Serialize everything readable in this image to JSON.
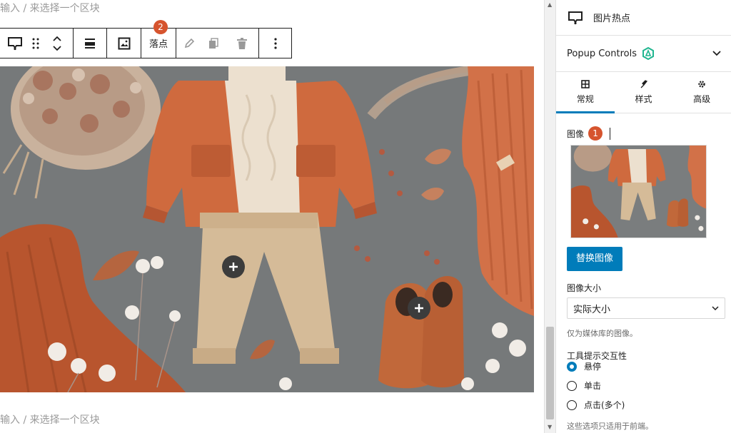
{
  "editor": {
    "placeholder_top": "输入 / 来选择一个区块",
    "placeholder_bottom": "输入 / 来选择一个区块",
    "toolbar": {
      "block_icon": "hotspot-block-icon",
      "drag_icon": "drag-handle-icon",
      "move_icon": "move-up-down-icon",
      "align_icon": "align-icon",
      "image_icon": "image-icon",
      "hotspot_label": "落点",
      "edit_icon": "pencil-icon",
      "duplicate_icon": "duplicate-icon",
      "delete_icon": "trash-icon",
      "more_icon": "more-vertical-icon",
      "badge": "2"
    },
    "hotspots": [
      {
        "icon": "plus-icon"
      },
      {
        "icon": "plus-icon"
      }
    ]
  },
  "sidebar": {
    "header_title": "图片热点",
    "panel_title": "Popup Controls",
    "tabs": [
      {
        "label": "常规",
        "icon": "general-icon",
        "active": true
      },
      {
        "label": "样式",
        "icon": "style-icon",
        "active": false
      },
      {
        "label": "高级",
        "icon": "gear-icon",
        "active": false
      }
    ],
    "image_label": "图像",
    "image_badge": "1",
    "replace_button": "替换图像",
    "size_label": "图像大小",
    "size_value": "实际大小",
    "size_help": "仅为媒体库的图像。",
    "trigger_label": "工具提示交互性",
    "trigger_options": [
      {
        "label": "悬停",
        "checked": true
      },
      {
        "label": "单击",
        "checked": false
      },
      {
        "label": "点击(多个)",
        "checked": false
      }
    ],
    "trigger_help": "这些选项只适用于前端。"
  },
  "colors": {
    "accent": "#007cba",
    "badge": "#d6542e",
    "hotspot": "#3c3c3c"
  }
}
